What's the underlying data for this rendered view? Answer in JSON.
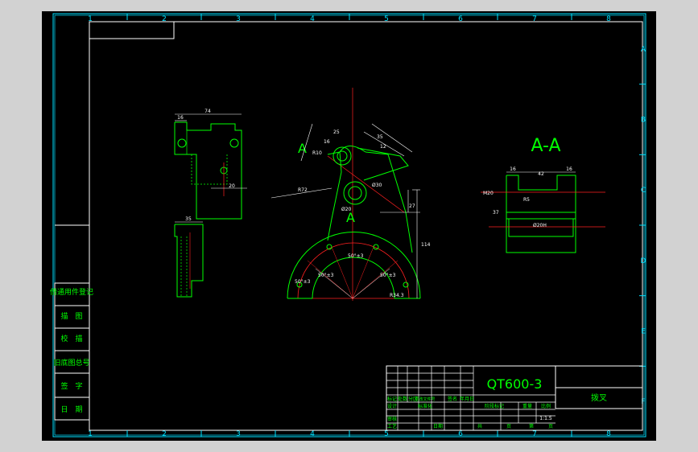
{
  "colors": {
    "background": "#000000",
    "border": "#00e0ff",
    "outline": "#00ff00",
    "dimension": "#ffffff",
    "centerline": "#ff2020",
    "title_text": "#00ff00"
  },
  "grid": {
    "columns": [
      "1",
      "2",
      "3",
      "4",
      "5",
      "6",
      "7",
      "8"
    ],
    "rows": [
      "A",
      "B",
      "C",
      "D",
      "E",
      "F"
    ]
  },
  "side_panel": {
    "items": [
      "借通用件登记",
      "描　图",
      "校　描",
      "旧底图总号",
      "签　字",
      "日　期"
    ]
  },
  "views": {
    "section_title": "A-A",
    "section_marker": "A",
    "left_view_dims": [
      "74",
      "16",
      "20",
      "35"
    ],
    "main_view_dims": [
      "25",
      "16",
      "R10",
      "35",
      "12",
      "R72",
      "Ø20",
      "Ø30",
      "27",
      "114",
      "50°±3",
      "50°±3",
      "50°±3",
      "50°±3",
      "R34.3"
    ],
    "section_view_dims": [
      "16",
      "42",
      "16",
      "M20",
      "R5",
      "37",
      "Ø20H"
    ]
  },
  "title_block": {
    "material": "QT600-3",
    "part_name": "拨叉",
    "scale": "1:1.5",
    "row_labels": [
      "标记",
      "处数",
      "分区",
      "更改文件号",
      "签名",
      "年月日"
    ],
    "row_design": [
      "设计",
      "标准化"
    ],
    "row_stage_headers": [
      "阶段标记",
      "重量",
      "比例"
    ],
    "row_review": "审核",
    "row_process": [
      "工艺",
      "日期"
    ],
    "row_sheets": [
      "共",
      "页",
      "第",
      "页"
    ]
  }
}
